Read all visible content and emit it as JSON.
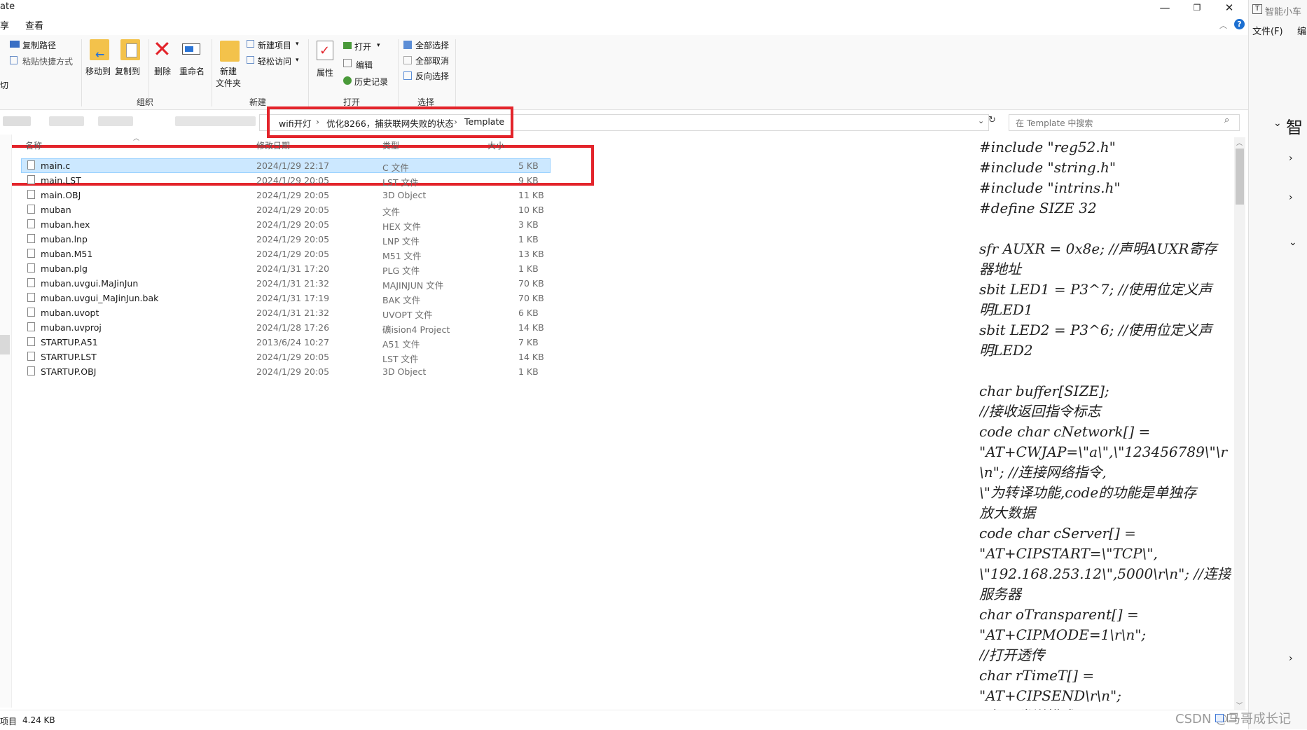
{
  "menu": {
    "file_partial": "ate",
    "share_partial": "享",
    "view": "查看"
  },
  "window_buttons": {
    "minimize": "—",
    "maximize": "❐",
    "close": "✕"
  },
  "ribbon": {
    "copy_path": "复制路径",
    "paste_shortcut": "粘贴快捷方式",
    "cut_partial": "切",
    "move_to": "移动到",
    "copy_to": "复制到",
    "delete": "删除",
    "rename": "重命名",
    "new_folder_line1": "新建",
    "new_folder_line2": "文件夹",
    "new_item": "新建项目",
    "easy_access": "轻松访问",
    "properties": "属性",
    "open": "打开",
    "edit": "编辑",
    "history": "历史记录",
    "select_all": "全部选择",
    "select_none": "全部取消",
    "invert_selection": "反向选择",
    "groups": {
      "organize": "组织",
      "new": "新建",
      "open": "打开",
      "select": "选择"
    }
  },
  "breadcrumb": [
    "wifi开灯",
    "优化8266，捕获联网失败的状态",
    "Template"
  ],
  "breadcrumb_sep": "›",
  "search": {
    "placeholder": "在 Template 中搜索"
  },
  "columns": {
    "name": "名称",
    "date": "修改日期",
    "type": "类型",
    "size": "大小"
  },
  "files": [
    {
      "name": "main.c",
      "date": "2024/1/29 22:17",
      "type": "C 文件",
      "size": "5 KB",
      "selected": true
    },
    {
      "name": "main.LST",
      "date": "2024/1/29 20:05",
      "type": "LST 文件",
      "size": "9 KB"
    },
    {
      "name": "main.OBJ",
      "date": "2024/1/29 20:05",
      "type": "3D Object",
      "size": "11 KB"
    },
    {
      "name": "muban",
      "date": "2024/1/29 20:05",
      "type": "文件",
      "size": "10 KB"
    },
    {
      "name": "muban.hex",
      "date": "2024/1/29 20:05",
      "type": "HEX 文件",
      "size": "3 KB"
    },
    {
      "name": "muban.lnp",
      "date": "2024/1/29 20:05",
      "type": "LNP 文件",
      "size": "1 KB"
    },
    {
      "name": "muban.M51",
      "date": "2024/1/29 20:05",
      "type": "M51 文件",
      "size": "13 KB"
    },
    {
      "name": "muban.plg",
      "date": "2024/1/31 17:20",
      "type": "PLG 文件",
      "size": "1 KB"
    },
    {
      "name": "muban.uvgui.MaJinJun",
      "date": "2024/1/31 21:32",
      "type": "MAJINJUN 文件",
      "size": "70 KB"
    },
    {
      "name": "muban.uvgui_MaJinJun.bak",
      "date": "2024/1/31 17:19",
      "type": "BAK 文件",
      "size": "70 KB"
    },
    {
      "name": "muban.uvopt",
      "date": "2024/1/31 21:32",
      "type": "UVOPT 文件",
      "size": "6 KB"
    },
    {
      "name": "muban.uvproj",
      "date": "2024/1/28 17:26",
      "type": "礦ision4 Project",
      "size": "14 KB"
    },
    {
      "name": "STARTUP.A51",
      "date": "2013/6/24 10:27",
      "type": "A51 文件",
      "size": "7 KB"
    },
    {
      "name": "STARTUP.LST",
      "date": "2024/1/29 20:05",
      "type": "LST 文件",
      "size": "14 KB"
    },
    {
      "name": "STARTUP.OBJ",
      "date": "2024/1/29 20:05",
      "type": "3D Object",
      "size": "1 KB"
    }
  ],
  "code_lines": [
    "#include \"reg52.h\"",
    "#include \"string.h\"",
    "#include \"intrins.h\"",
    "#define SIZE 32",
    "",
    "sfr AUXR = 0x8e;  //声明AUXR寄存",
    "器地址",
    "sbit LED1 = P3^7;  //使用位定义声",
    "明LED1",
    "sbit LED2 = P3^6;  //使用位定义声",
    "明LED2",
    "",
    "char buffer[SIZE];",
    "//接收返回指令标志",
    "code char cNetwork[]   =",
    "\"AT+CWJAP=\\\"a\\\",\\\"123456789\\\"\\r",
    "\\n\";          //连接网络指令,",
    "\\\"为转译功能,code的功能是单独存",
    "放大数据",
    "code char cServer[]   =",
    "\"AT+CIPSTART=\\\"TCP\\\",",
    "\\\"192.168.253.12\\\",5000\\r\\n\";  //连接",
    "服务器",
    "char oTransparent[]   =",
    "\"AT+CIPMODE=1\\r\\n\";",
    "//打开透传",
    "char rTimeT[]        =",
    "\"AT+CIPSEND\\r\\n\";",
    "//打开发送模式"
  ],
  "right_strip": {
    "title": "智能小车",
    "menu_file": "文件(F)",
    "menu_edit_partial": "编",
    "tree_partial": "智"
  },
  "status": {
    "items_partial": "项目",
    "selected_size": "4.24 KB"
  },
  "watermark": "CSDN @马哥成长记",
  "colors": {
    "highlight_box": "#e3242b",
    "selection": "#cce8ff",
    "selection_border": "#99d1ff"
  }
}
